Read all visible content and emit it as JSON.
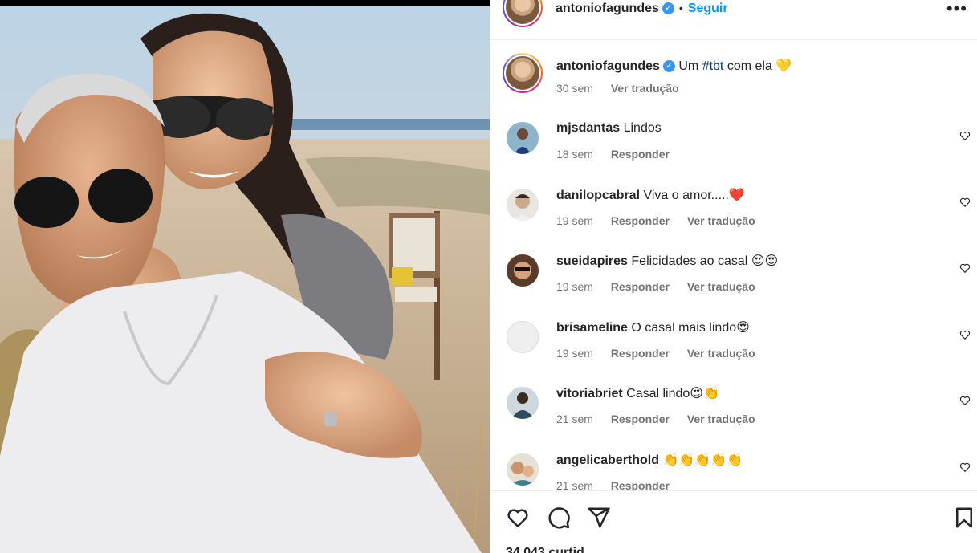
{
  "post": {
    "author": "antoniofagundes",
    "follow_label": "Seguir",
    "more_label": "•••"
  },
  "caption": {
    "username": "antoniofagundes",
    "text_before": "Um",
    "hashtag": "#tbt",
    "text_after": "com ela",
    "emoji": "💛",
    "age": "30 sem",
    "translate": "Ver tradução"
  },
  "comments": [
    {
      "username": "mjsdantas",
      "text": "Lindos",
      "emoji": "",
      "age": "18 sem",
      "reply": "Responder",
      "translate": ""
    },
    {
      "username": "danilopcabral",
      "text": "Viva o amor.....",
      "emoji": "❤️",
      "age": "19 sem",
      "reply": "Responder",
      "translate": "Ver tradução"
    },
    {
      "username": "sueidapires",
      "text": "Felicidades ao casal",
      "emoji": "😍😍",
      "age": "19 sem",
      "reply": "Responder",
      "translate": "Ver tradução"
    },
    {
      "username": "brisameline",
      "text": "O casal mais lindo",
      "emoji": "😍",
      "age": "19 sem",
      "reply": "Responder",
      "translate": "Ver tradução"
    },
    {
      "username": "vitoriabriet",
      "text": "Casal lindo",
      "emoji": "😍👏",
      "age": "21 sem",
      "reply": "Responder",
      "translate": "Ver tradução"
    },
    {
      "username": "angelicaberthold",
      "text": "",
      "emoji": "👏👏👏👏👏",
      "age": "21 sem",
      "reply": "Responder",
      "translate": ""
    }
  ],
  "footer": {
    "likes_partial": "34.043 curtid"
  },
  "icons": {
    "like": "heart-icon",
    "comment": "comment-icon",
    "share": "share-icon",
    "save": "bookmark-icon"
  },
  "colors": {
    "link": "#0095f6",
    "hashtag": "#00376b",
    "muted": "#737373",
    "text": "#262626"
  }
}
